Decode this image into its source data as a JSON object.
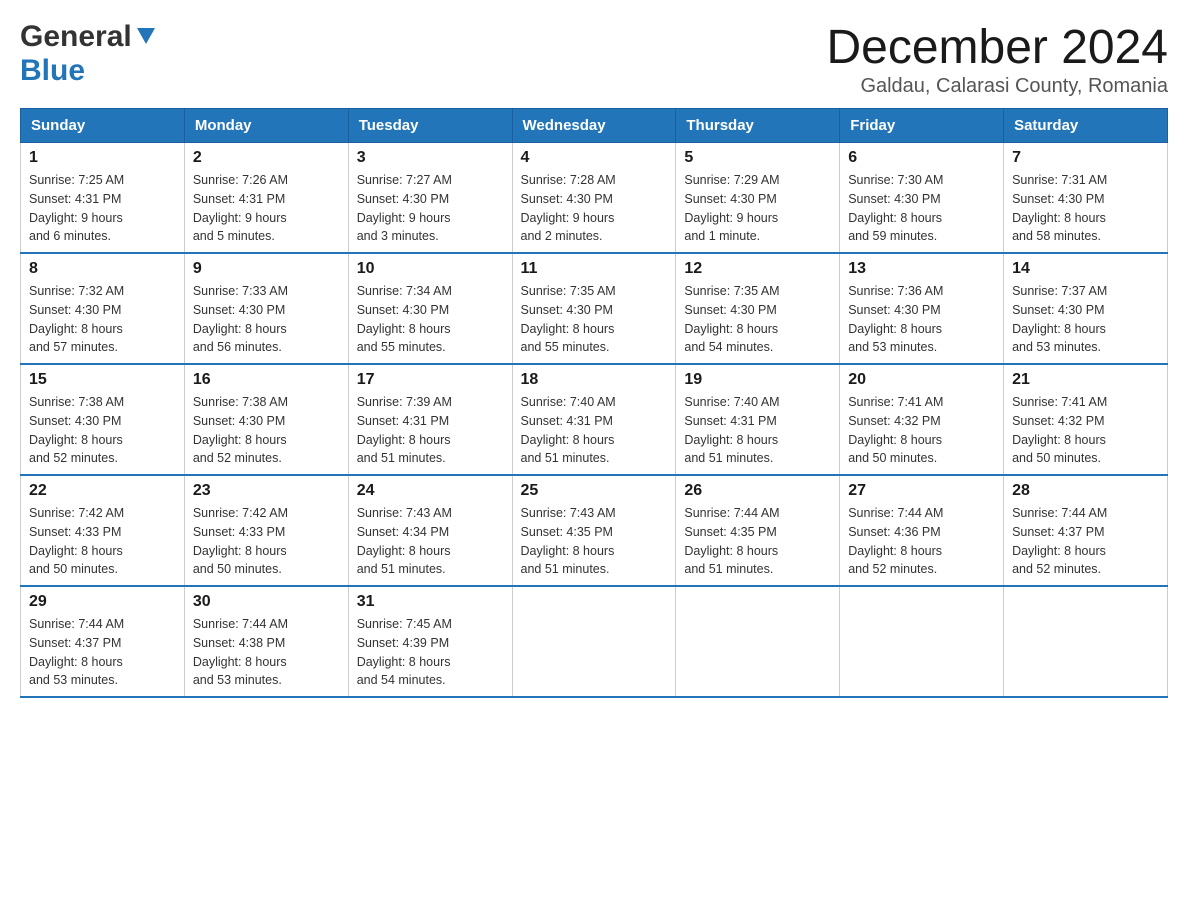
{
  "header": {
    "logo_general": "General",
    "logo_blue": "Blue",
    "month_year": "December 2024",
    "location": "Galdau, Calarasi County, Romania"
  },
  "days_of_week": [
    "Sunday",
    "Monday",
    "Tuesday",
    "Wednesday",
    "Thursday",
    "Friday",
    "Saturday"
  ],
  "weeks": [
    [
      {
        "day": "1",
        "sunrise": "7:25 AM",
        "sunset": "4:31 PM",
        "daylight": "9 hours and 6 minutes."
      },
      {
        "day": "2",
        "sunrise": "7:26 AM",
        "sunset": "4:31 PM",
        "daylight": "9 hours and 5 minutes."
      },
      {
        "day": "3",
        "sunrise": "7:27 AM",
        "sunset": "4:30 PM",
        "daylight": "9 hours and 3 minutes."
      },
      {
        "day": "4",
        "sunrise": "7:28 AM",
        "sunset": "4:30 PM",
        "daylight": "9 hours and 2 minutes."
      },
      {
        "day": "5",
        "sunrise": "7:29 AM",
        "sunset": "4:30 PM",
        "daylight": "9 hours and 1 minute."
      },
      {
        "day": "6",
        "sunrise": "7:30 AM",
        "sunset": "4:30 PM",
        "daylight": "8 hours and 59 minutes."
      },
      {
        "day": "7",
        "sunrise": "7:31 AM",
        "sunset": "4:30 PM",
        "daylight": "8 hours and 58 minutes."
      }
    ],
    [
      {
        "day": "8",
        "sunrise": "7:32 AM",
        "sunset": "4:30 PM",
        "daylight": "8 hours and 57 minutes."
      },
      {
        "day": "9",
        "sunrise": "7:33 AM",
        "sunset": "4:30 PM",
        "daylight": "8 hours and 56 minutes."
      },
      {
        "day": "10",
        "sunrise": "7:34 AM",
        "sunset": "4:30 PM",
        "daylight": "8 hours and 55 minutes."
      },
      {
        "day": "11",
        "sunrise": "7:35 AM",
        "sunset": "4:30 PM",
        "daylight": "8 hours and 55 minutes."
      },
      {
        "day": "12",
        "sunrise": "7:35 AM",
        "sunset": "4:30 PM",
        "daylight": "8 hours and 54 minutes."
      },
      {
        "day": "13",
        "sunrise": "7:36 AM",
        "sunset": "4:30 PM",
        "daylight": "8 hours and 53 minutes."
      },
      {
        "day": "14",
        "sunrise": "7:37 AM",
        "sunset": "4:30 PM",
        "daylight": "8 hours and 53 minutes."
      }
    ],
    [
      {
        "day": "15",
        "sunrise": "7:38 AM",
        "sunset": "4:30 PM",
        "daylight": "8 hours and 52 minutes."
      },
      {
        "day": "16",
        "sunrise": "7:38 AM",
        "sunset": "4:30 PM",
        "daylight": "8 hours and 52 minutes."
      },
      {
        "day": "17",
        "sunrise": "7:39 AM",
        "sunset": "4:31 PM",
        "daylight": "8 hours and 51 minutes."
      },
      {
        "day": "18",
        "sunrise": "7:40 AM",
        "sunset": "4:31 PM",
        "daylight": "8 hours and 51 minutes."
      },
      {
        "day": "19",
        "sunrise": "7:40 AM",
        "sunset": "4:31 PM",
        "daylight": "8 hours and 51 minutes."
      },
      {
        "day": "20",
        "sunrise": "7:41 AM",
        "sunset": "4:32 PM",
        "daylight": "8 hours and 50 minutes."
      },
      {
        "day": "21",
        "sunrise": "7:41 AM",
        "sunset": "4:32 PM",
        "daylight": "8 hours and 50 minutes."
      }
    ],
    [
      {
        "day": "22",
        "sunrise": "7:42 AM",
        "sunset": "4:33 PM",
        "daylight": "8 hours and 50 minutes."
      },
      {
        "day": "23",
        "sunrise": "7:42 AM",
        "sunset": "4:33 PM",
        "daylight": "8 hours and 50 minutes."
      },
      {
        "day": "24",
        "sunrise": "7:43 AM",
        "sunset": "4:34 PM",
        "daylight": "8 hours and 51 minutes."
      },
      {
        "day": "25",
        "sunrise": "7:43 AM",
        "sunset": "4:35 PM",
        "daylight": "8 hours and 51 minutes."
      },
      {
        "day": "26",
        "sunrise": "7:44 AM",
        "sunset": "4:35 PM",
        "daylight": "8 hours and 51 minutes."
      },
      {
        "day": "27",
        "sunrise": "7:44 AM",
        "sunset": "4:36 PM",
        "daylight": "8 hours and 52 minutes."
      },
      {
        "day": "28",
        "sunrise": "7:44 AM",
        "sunset": "4:37 PM",
        "daylight": "8 hours and 52 minutes."
      }
    ],
    [
      {
        "day": "29",
        "sunrise": "7:44 AM",
        "sunset": "4:37 PM",
        "daylight": "8 hours and 53 minutes."
      },
      {
        "day": "30",
        "sunrise": "7:44 AM",
        "sunset": "4:38 PM",
        "daylight": "8 hours and 53 minutes."
      },
      {
        "day": "31",
        "sunrise": "7:45 AM",
        "sunset": "4:39 PM",
        "daylight": "8 hours and 54 minutes."
      },
      null,
      null,
      null,
      null
    ]
  ],
  "labels": {
    "sunrise": "Sunrise:",
    "sunset": "Sunset:",
    "daylight": "Daylight:"
  }
}
